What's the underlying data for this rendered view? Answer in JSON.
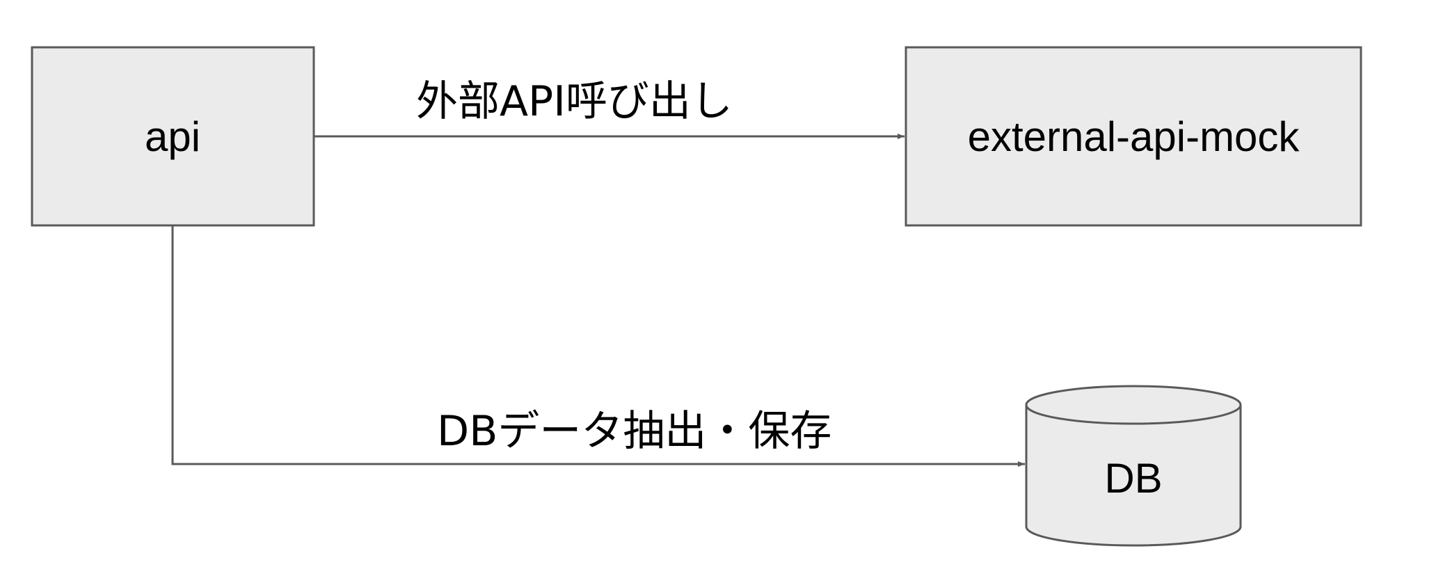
{
  "diagram": {
    "colors": {
      "node_fill": "#ebebeb",
      "stroke": "#595959",
      "text": "#000000"
    },
    "nodes": {
      "api": {
        "label": "api",
        "shape": "rectangle"
      },
      "external": {
        "label": "external-api-mock",
        "shape": "rectangle"
      },
      "db": {
        "label": "DB",
        "shape": "cylinder"
      }
    },
    "edges": {
      "api_to_external": {
        "label": "外部API呼び出し",
        "from": "api",
        "to": "external-api-mock"
      },
      "api_to_db": {
        "label": "DBデータ抽出・保存",
        "from": "api",
        "to": "DB"
      }
    }
  }
}
